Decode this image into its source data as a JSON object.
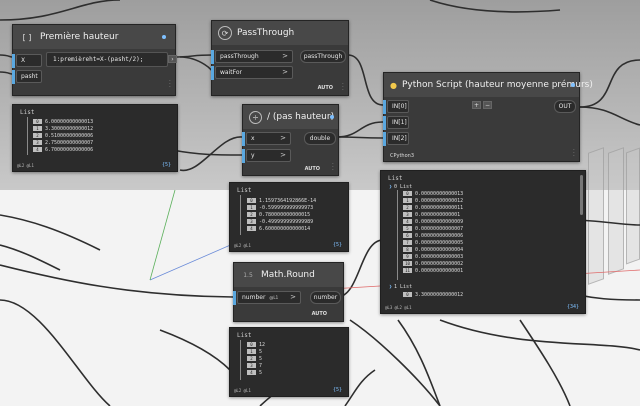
{
  "nodes": {
    "premiere": {
      "icon": "[ ]",
      "title": "Première hauteur",
      "inputs": [
        "X",
        "pasht"
      ],
      "code": "1:premièreht=X-(pasht/2);",
      "preview": {
        "label": "List",
        "items": [
          {
            "i": "0",
            "v": "6.00000000000013"
          },
          {
            "i": "1",
            "v": "3.30000000000012"
          },
          {
            "i": "2",
            "v": "0.51000000000006"
          },
          {
            "i": "3",
            "v": "2.75000000000007"
          },
          {
            "i": "4",
            "v": "6.70000000000006"
          }
        ],
        "footer": "@L2 @L1",
        "count": "{5}"
      }
    },
    "passthrough": {
      "title": "PassThrough",
      "inputs": [
        "passThrough",
        "waitFor"
      ],
      "output": "passThrough",
      "auto": "AUTO"
    },
    "division": {
      "icon": "÷",
      "title": "/ (pas hauteur)",
      "inputs": [
        "x",
        "y"
      ],
      "output": "double",
      "auto": "AUTO",
      "preview": {
        "label": "List",
        "items": [
          {
            "i": "0",
            "v": "1.1597364192866E-14"
          },
          {
            "i": "1",
            "v": "-0.599999999999973"
          },
          {
            "i": "2",
            "v": "0.780000000000015"
          },
          {
            "i": "3",
            "v": "-0.499999999999989"
          },
          {
            "i": "4",
            "v": "6.600000000000014"
          }
        ],
        "footer": "@L2 @L1",
        "count": "{5}"
      }
    },
    "python": {
      "title": "Python Script (hauteur moyenne prémurs)",
      "inputs": [
        "IN[0]",
        "IN[1]",
        "IN[2]"
      ],
      "output": "OUT",
      "badge": "CPython3",
      "plus": "+",
      "minus": "−",
      "preview": {
        "label": "List",
        "sub0": "0 List",
        "items": [
          {
            "i": "0",
            "v": "0.00000000000013"
          },
          {
            "i": "1",
            "v": "0.00000000000012"
          },
          {
            "i": "2",
            "v": "0.00000000000011"
          },
          {
            "i": "3",
            "v": "0.0000000000001"
          },
          {
            "i": "4",
            "v": "0.00000000000009"
          },
          {
            "i": "5",
            "v": "0.00000000000007"
          },
          {
            "i": "6",
            "v": "0.00000000000006"
          },
          {
            "i": "7",
            "v": "0.00000000000005"
          },
          {
            "i": "8",
            "v": "0.00000000000004"
          },
          {
            "i": "9",
            "v": "0.00000000000003"
          },
          {
            "i": "10",
            "v": "0.00000000000002"
          },
          {
            "i": "11",
            "v": "0.00000000000001"
          }
        ],
        "sub1": "1 List",
        "sub1_first": {
          "i": "0",
          "v": "3.30000000000012"
        },
        "footer": "@L3 @L2 @L1",
        "count": "{34}"
      }
    },
    "round": {
      "icon": "1.5",
      "title": "Math.Round",
      "input": "number",
      "input_tag": "@L1",
      "output": "number",
      "auto": "AUTO",
      "preview": {
        "label": "List",
        "items": [
          {
            "i": "0",
            "v": "12"
          },
          {
            "i": "1",
            "v": "5"
          },
          {
            "i": "2",
            "v": "5"
          },
          {
            "i": "3",
            "v": "7"
          },
          {
            "i": "4",
            "v": "5"
          }
        ],
        "footer": "@L2 @L1",
        "count": "{5}"
      }
    }
  },
  "colors": {
    "node_bg": "#3a3a3a",
    "node_header": "#484848",
    "preview_bg": "#2b2b2b",
    "wire": "#2e2e2e",
    "accent": "#7fc0ff"
  }
}
